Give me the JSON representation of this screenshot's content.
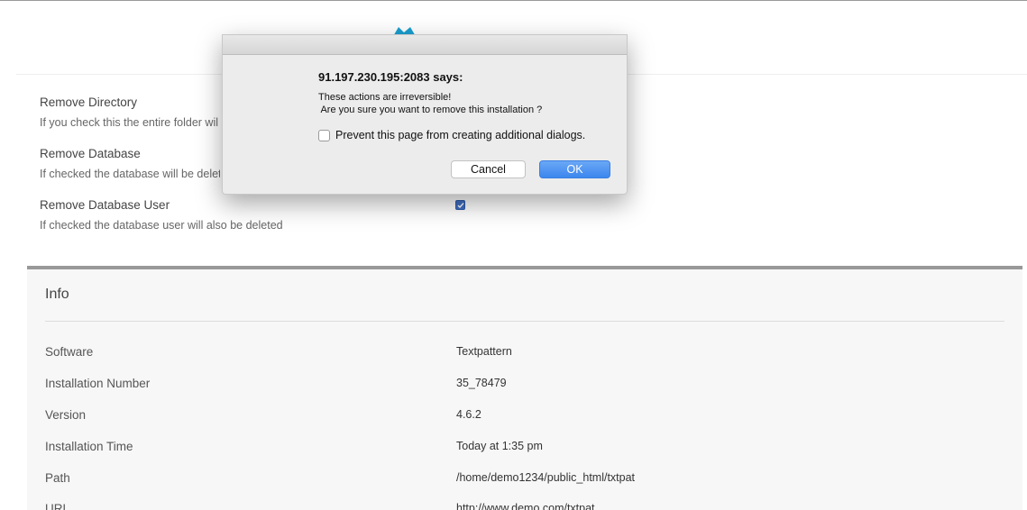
{
  "options": [
    {
      "title": "Remove Directory",
      "description": "If you check this the entire folder wil"
    },
    {
      "title": "Remove Database",
      "description": "If checked the database will be delet"
    },
    {
      "title": "Remove Database User",
      "description": "If checked the database user will also be deleted",
      "checked": true
    }
  ],
  "info": {
    "heading": "Info",
    "rows": [
      {
        "label": "Software",
        "value": "Textpattern"
      },
      {
        "label": "Installation Number",
        "value": "35_78479"
      },
      {
        "label": "Version",
        "value": "4.6.2"
      },
      {
        "label": "Installation Time",
        "value": "Today at 1:35 pm"
      },
      {
        "label": "Path",
        "value": "/home/demo1234/public_html/txtpat"
      },
      {
        "label": "URL",
        "value": "http://www.demo.com/txtpat"
      }
    ]
  },
  "dialog": {
    "origin": "91.197.230.195:2083 says:",
    "message_line1": "These actions are irreversible!",
    "message_line2": " Are you sure you want to remove this installation ?",
    "prevent_label": "Prevent this page from creating additional dialogs.",
    "prevent_checked": false,
    "cancel_label": "Cancel",
    "ok_label": "OK"
  },
  "colors": {
    "ok_button": "#3c86ee",
    "checkbox_checked": "#3f6fc4",
    "logo": "#1a9fd0"
  }
}
